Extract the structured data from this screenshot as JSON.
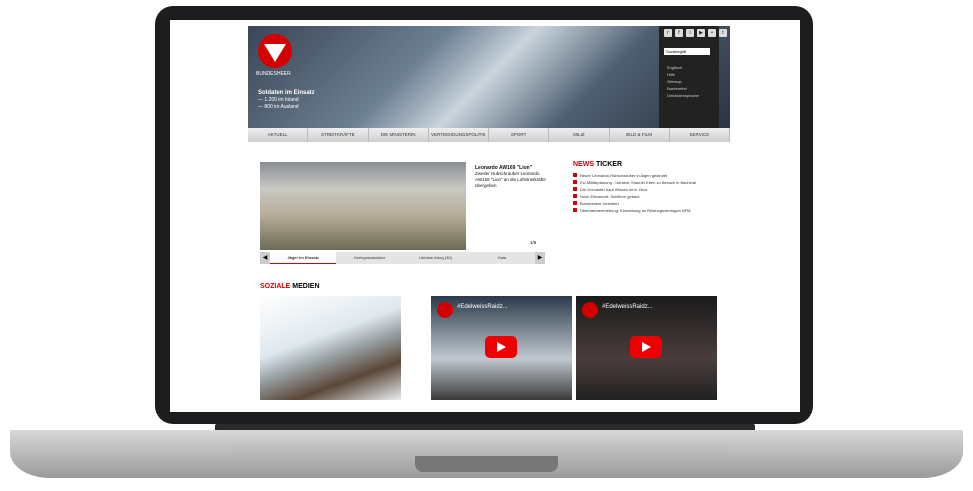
{
  "header": {
    "logo_text": "BUNDESHEER",
    "mission_title": "Soldaten im Einsatz",
    "mission_lines": [
      "— 1.200 im Inland",
      "— 800 im Ausland"
    ]
  },
  "utility": {
    "search_placeholder": "Suchbegriff",
    "links": [
      "Englisch",
      "Hilfe",
      "Sitemap",
      "Barrierefrei",
      "Gebärdensprache"
    ]
  },
  "nav": {
    "items": [
      "AKTUELL",
      "STREITKRÄFTE",
      "DIE MINISTERIN",
      "VERTEIDIGUNGSPOLITIK",
      "SPORT",
      "MILIZ",
      "BILD & FILM",
      "SERVICE"
    ]
  },
  "slider": {
    "caption_title": "Leonardo AW169 \"Lion\"",
    "caption_text": "Zweiter Hubschrauber Leonardo AW169 \"Lion\" an die Luftstreitkräfte übergeben",
    "count": "1/5",
    "tabs": [
      "Jäger im Einsatz",
      "Geringmuskulatur",
      "Ukraine-Krieg (30)",
      "Gala"
    ]
  },
  "ticker": {
    "title_red": "NEWS",
    "title_black": "TICKER",
    "items": [
      "Neuer Leonardo-Hubschrauber in Aigen gelandet",
      "EU-Militärplanung - Ukraine: Klaunet Eben zu Besuch in Bachinal",
      "Die Grenadier baut Wissen ist in Zeus",
      "Noch Einsatzort: Schifforn gebaut",
      "Bundesheer investiert",
      "Übernahmeerhebung: Einweisung an Rüstungsvertragen BFM"
    ]
  },
  "social": {
    "title_red": "SOZIALE",
    "title_black": "MEDIEN",
    "videos": [
      "#EdelweissRaidz...",
      "#EdelweissRaidz..."
    ]
  }
}
